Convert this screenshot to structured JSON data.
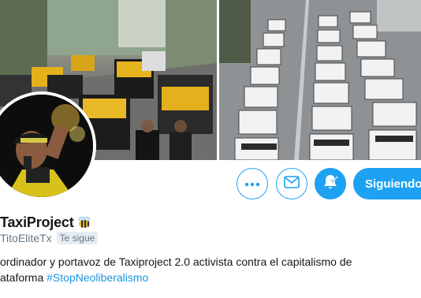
{
  "banner": {
    "left_photo": "taxis-street-protest",
    "right_photo": "taxis-lined-avenue"
  },
  "profile": {
    "display_name": "TaxiProject",
    "name_emoji": "bee-icon",
    "handle": "TitoEliteTx",
    "follows_you": "Te sigue",
    "bio_line1": "ordinador y portavoz de Taxiproject 2.0 activista contra el capitalismo de",
    "bio_line2_prefix": "ataforma ",
    "bio_hashtag": "#StopNeoliberalismo"
  },
  "actions": {
    "more_icon": "more-icon",
    "dm_icon": "envelope-icon",
    "bell_icon": "bell-check-icon",
    "follow_label": "Siguiendo"
  },
  "colors": {
    "accent": "#1da1f2",
    "hashtag": "#1b95e0",
    "secondary_text": "#657786"
  }
}
